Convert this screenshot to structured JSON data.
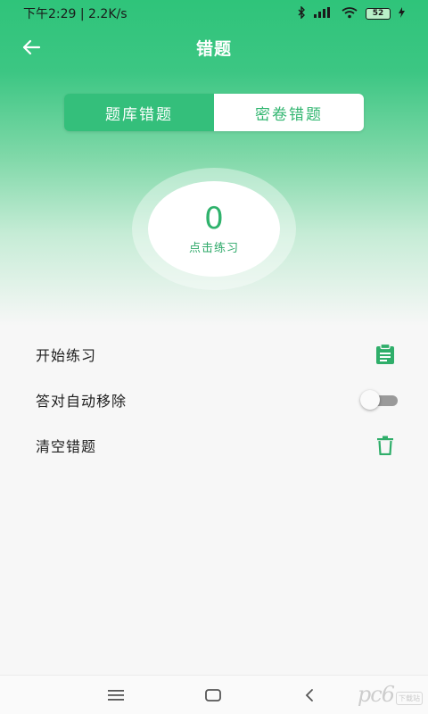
{
  "status_bar": {
    "time_speed": "下午2:29 | 2.2K/s",
    "battery": "52"
  },
  "navbar": {
    "title": "错题"
  },
  "segment": {
    "tabs": [
      {
        "label": "题库错题",
        "active": true
      },
      {
        "label": "密卷错题",
        "active": false
      }
    ]
  },
  "counter": {
    "value": "0",
    "label": "点击练习"
  },
  "options": [
    {
      "label": "开始练习",
      "icon": "clipboard-icon"
    },
    {
      "label": "答对自动移除",
      "toggle_on": false
    },
    {
      "label": "清空错题",
      "icon": "trash-icon"
    }
  ],
  "watermark": {
    "text": "pc6",
    "box": "下载站"
  },
  "colors": {
    "accent": "#34bf7b",
    "accent_text": "#2fb26c"
  }
}
